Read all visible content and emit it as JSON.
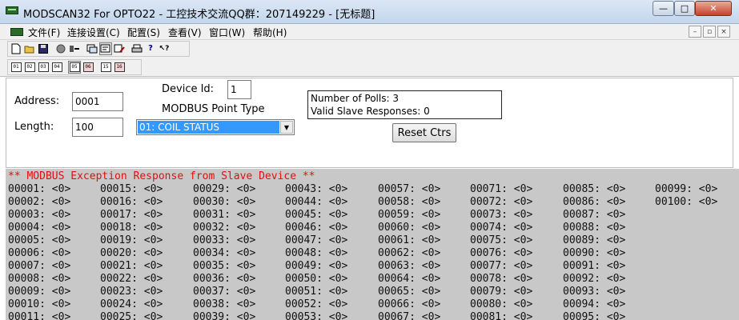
{
  "window": {
    "title": "MODSCAN32 For OPTO22 - 工控技术交流QQ群：207149229 - [无标题]",
    "min_label": "—",
    "max_label": "□",
    "close_label": "✕"
  },
  "menu": {
    "items": [
      "文件(F)",
      "连接设置(C)",
      "配置(S)",
      "查看(V)",
      "窗口(W)",
      "帮助(H)"
    ],
    "mdi_min": "–",
    "mdi_restore": "▫",
    "mdi_close": "×"
  },
  "toolbar": {
    "row1": [
      "new-icon",
      "open-icon",
      "save-icon",
      "record-icon",
      "connect-icon",
      "display-options-icon",
      "text-icon",
      "write-icon",
      "print-icon",
      "help-icon",
      "context-help-icon"
    ],
    "row2_labels": [
      "01",
      "02",
      "03",
      "04",
      "05",
      "06",
      "15",
      "16"
    ]
  },
  "form": {
    "address_label": "Address:",
    "address_value": "0001",
    "length_label": "Length:",
    "length_value": "100",
    "device_id_label": "Device Id:",
    "device_id_value": "1",
    "point_type_label": "MODBUS Point Type",
    "point_type_value": "01: COIL STATUS",
    "polls_text": "Number of Polls: 3",
    "responses_text": "Valid Slave Responses: 0",
    "reset_label": "Reset Ctrs"
  },
  "data": {
    "exception": "** MODBUS Exception Response from Slave Device **",
    "columns": [
      [
        "00001: <0>",
        "00002: <0>",
        "00003: <0>",
        "00004: <0>",
        "00005: <0>",
        "00006: <0>",
        "00007: <0>",
        "00008: <0>",
        "00009: <0>",
        "00010: <0>",
        "00011: <0>"
      ],
      [
        "00015: <0>",
        "00016: <0>",
        "00017: <0>",
        "00018: <0>",
        "00019: <0>",
        "00020: <0>",
        "00021: <0>",
        "00022: <0>",
        "00023: <0>",
        "00024: <0>",
        "00025: <0>"
      ],
      [
        "00029: <0>",
        "00030: <0>",
        "00031: <0>",
        "00032: <0>",
        "00033: <0>",
        "00034: <0>",
        "00035: <0>",
        "00036: <0>",
        "00037: <0>",
        "00038: <0>",
        "00039: <0>"
      ],
      [
        "00043: <0>",
        "00044: <0>",
        "00045: <0>",
        "00046: <0>",
        "00047: <0>",
        "00048: <0>",
        "00049: <0>",
        "00050: <0>",
        "00051: <0>",
        "00052: <0>",
        "00053: <0>"
      ],
      [
        "00057: <0>",
        "00058: <0>",
        "00059: <0>",
        "00060: <0>",
        "00061: <0>",
        "00062: <0>",
        "00063: <0>",
        "00064: <0>",
        "00065: <0>",
        "00066: <0>",
        "00067: <0>"
      ],
      [
        "00071: <0>",
        "00072: <0>",
        "00073: <0>",
        "00074: <0>",
        "00075: <0>",
        "00076: <0>",
        "00077: <0>",
        "00078: <0>",
        "00079: <0>",
        "00080: <0>",
        "00081: <0>"
      ],
      [
        "00085: <0>",
        "00086: <0>",
        "00087: <0>",
        "00088: <0>",
        "00089: <0>",
        "00090: <0>",
        "00091: <0>",
        "00092: <0>",
        "00093: <0>",
        "00094: <0>",
        "00095: <0>"
      ],
      [
        "00099: <0>",
        "00100: <0>"
      ]
    ]
  }
}
